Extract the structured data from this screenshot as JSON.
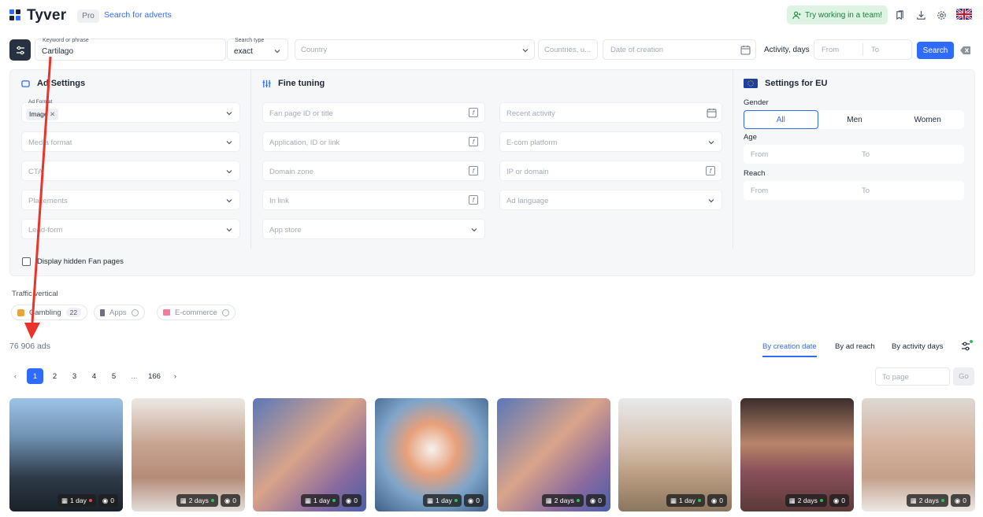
{
  "header": {
    "logo_text": "Tyver",
    "pro_badge": "Pro",
    "search_link": "Search for adverts",
    "team_button": "Try working in a team!"
  },
  "search": {
    "keyword_label": "Keyword or phrase",
    "keyword_value": "Cartilago",
    "search_type_label": "Search type",
    "search_type_value": "exact",
    "country_placeholder": "Country",
    "countries_placeholder": "Countries, u...",
    "date_placeholder": "Date of creation",
    "activity_label": "Activity, days",
    "from_placeholder": "From",
    "to_placeholder": "To",
    "search_button": "Search"
  },
  "ad_settings": {
    "title": "Ad Settings",
    "ad_format_label": "Ad Format",
    "ad_format_chip": "Image",
    "media_format": "Media format",
    "cta": "CTA",
    "placements": "Placements",
    "lead_form": "Lead-form"
  },
  "fine_tuning": {
    "title": "Fine tuning",
    "fan_page": "Fan page ID or title",
    "application": "Application, ID or link",
    "domain_zone": "Domain zone",
    "in_link": "In link",
    "app_store": "App store",
    "recent_activity": "Recent activity",
    "ecom_platform": "E-com platform",
    "ip_domain": "IP or domain",
    "ad_language": "Ad language"
  },
  "eu_settings": {
    "title": "Settings for EU",
    "gender_label": "Gender",
    "gender_all": "All",
    "gender_men": "Men",
    "gender_women": "Women",
    "age_label": "Age",
    "reach_label": "Reach",
    "from": "From",
    "to": "To"
  },
  "hidden_fanpages_label": "Display hidden Fan pages",
  "traffic": {
    "label": "Traffic vertical",
    "gambling": "Gambling",
    "gambling_count": "22",
    "apps": "Apps",
    "ecommerce": "E-commerce"
  },
  "results": {
    "count_text": "76 906 ads",
    "sort_creation": "By creation date",
    "sort_reach": "By ad reach",
    "sort_activity": "By activity days"
  },
  "pagination": {
    "pages": [
      "1",
      "2",
      "3",
      "4",
      "5",
      "...",
      "166"
    ],
    "to_page_placeholder": "To page",
    "go_button": "Go"
  },
  "cards": [
    {
      "days": "1 day",
      "views": "0",
      "dot": "#e5484d"
    },
    {
      "days": "2 days",
      "views": "0",
      "dot": "#2fbf5a"
    },
    {
      "days": "1 day",
      "views": "0",
      "dot": "#2fbf5a"
    },
    {
      "days": "1 day",
      "views": "0",
      "dot": "#2fbf5a"
    },
    {
      "days": "2 days",
      "views": "0",
      "dot": "#2fbf5a"
    },
    {
      "days": "1 day",
      "views": "0",
      "dot": "#2fbf5a"
    },
    {
      "days": "2 days",
      "views": "0",
      "dot": "#2fbf5a"
    },
    {
      "days": "2 days",
      "views": "0",
      "dot": "#2fbf5a"
    }
  ],
  "colors": {
    "accent": "#2f6bff",
    "annotation_arrow": "#e8342a",
    "team_green": "#17803a"
  }
}
